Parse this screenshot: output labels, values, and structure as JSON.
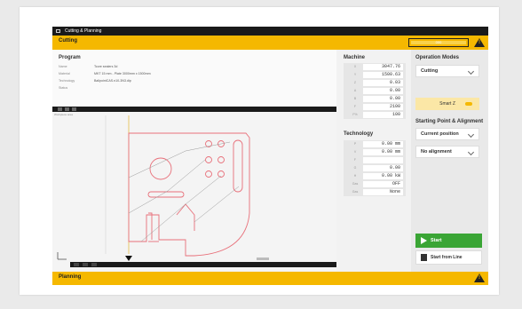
{
  "window": {
    "title": "Cutting & Planning"
  },
  "header": {
    "title": "Cutting",
    "field_value": "000"
  },
  "program": {
    "title": "Program",
    "rows": [
      {
        "label": "Name",
        "value": "Tcore sealers 3d"
      },
      {
        "label": "Material",
        "value": "MKT 15 mm - Plate 3000mm x 1500mm"
      },
      {
        "label": "Technology",
        "value": "BallpointCAS.n10-3N3.dip"
      },
      {
        "label": "Status",
        "value": ""
      }
    ]
  },
  "drawing": {
    "label": "Workpiece area"
  },
  "machine": {
    "title": "Machine",
    "rows": [
      {
        "key": "X",
        "value": "3047.76"
      },
      {
        "key": "Y",
        "value": "1500.63"
      },
      {
        "key": "Z",
        "value": "0.03"
      },
      {
        "key": "A",
        "value": "0.00"
      },
      {
        "key": "B",
        "value": "0.00"
      },
      {
        "key": "F",
        "value": "2100"
      },
      {
        "key": "F%",
        "value": "100"
      }
    ]
  },
  "technology": {
    "title": "Technology",
    "rows": [
      {
        "key": "P",
        "value": "0.00 mm"
      },
      {
        "key": "V",
        "value": "0.00 mm"
      },
      {
        "key": "F",
        "value": ""
      },
      {
        "key": "G",
        "value": "0.00"
      },
      {
        "key": "H",
        "value": "0.00 kW"
      },
      {
        "key": "Gas",
        "value": "OFF"
      },
      {
        "key": "Gas",
        "value": "None"
      }
    ]
  },
  "operation": {
    "title": "Operation Modes",
    "mode": "Cutting",
    "smart_label": "Smart Z"
  },
  "starting": {
    "title": "Starting Point & Alignment",
    "position": "Current position",
    "alignment": "No alignment"
  },
  "actions": {
    "start": "Start",
    "start_from_line": "Start from Line"
  },
  "footer": {
    "title": "Planning"
  },
  "colors": {
    "accent": "#f5b800",
    "start": "#3aa535",
    "cut_path": "#e8707a"
  }
}
